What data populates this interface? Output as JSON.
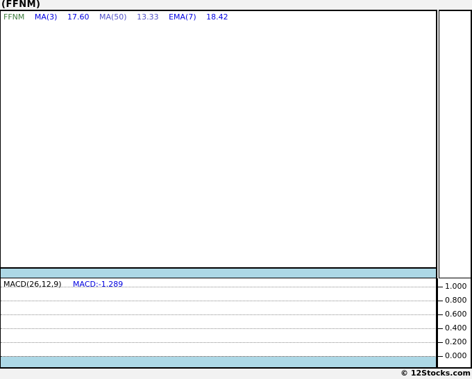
{
  "window": {
    "title": "(FFNM)",
    "watermark": "© 12Stocks.com"
  },
  "price_panel": {
    "symbol": "FFNM",
    "indicators": [
      {
        "label": "MA(3)",
        "value": "17.60"
      },
      {
        "label": "MA(50)",
        "value": "13.33"
      },
      {
        "label": "EMA(7)",
        "value": "18.42"
      }
    ]
  },
  "macd_panel": {
    "label": "MACD(26,12,9)",
    "reading": "MACD:-1.289",
    "ytick_labels": [
      "1.000",
      "0.800",
      "0.600",
      "0.400",
      "0.200",
      "0.000"
    ]
  },
  "colors": {
    "symbol_green": "#3e7c3e",
    "indicator_blue": "#0000e0",
    "ma50_purple": "#5151c8",
    "band_lightblue": "#add8e6",
    "gridline_gray": "#8c8c8c",
    "background_gray": "#f2f2f2",
    "border_black": "#000000"
  },
  "chart_data": [
    {
      "type": "line",
      "title": "(FFNM)",
      "panel": "price",
      "legend_entries": [
        "FFNM",
        "MA(3) 17.60",
        "MA(50) 13.33",
        "EMA(7) 18.42"
      ],
      "indicator_values": {
        "MA(3)": 17.6,
        "MA(50)": 13.33,
        "EMA(7)": 18.42
      },
      "series": [],
      "note": "price panel is empty - no plotted data visible",
      "grid": false,
      "legend_position": "top-left"
    },
    {
      "type": "line",
      "title": "MACD(26,12,9)",
      "panel": "macd",
      "macd_value": -1.289,
      "series": [],
      "note": "no MACD curve visible within axis range",
      "ylim": [
        0.0,
        1.0
      ],
      "yticks": [
        1.0,
        0.8,
        0.6,
        0.4,
        0.2,
        0.0
      ],
      "ytick_labels": [
        "1.000",
        "0.800",
        "0.600",
        "0.400",
        "0.200",
        "0.000"
      ],
      "grid": true,
      "grid_style": "horizontal dotted",
      "axis_position": "right",
      "zero_band_color": "#add8e6"
    }
  ]
}
